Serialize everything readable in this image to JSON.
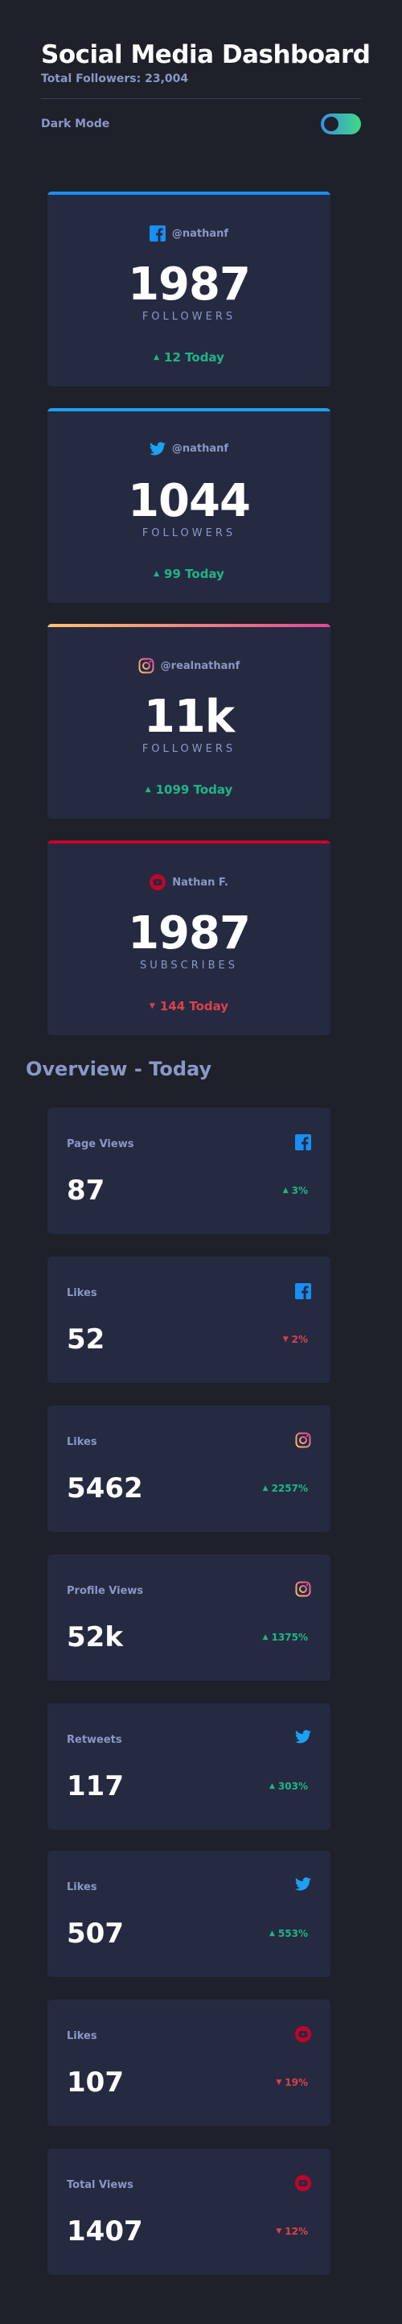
{
  "header": {
    "title": "Social Media Dashboard",
    "total_followers": "Total Followers: 23,004"
  },
  "dark_mode": {
    "label": "Dark Mode",
    "enabled": true
  },
  "colors": {
    "facebook": "#178ff5",
    "twitter": "#1ca0f2",
    "instagram_gradient": [
      "#fdc468",
      "#df4996"
    ],
    "youtube": "#c4032a",
    "up": "#1eb589",
    "down": "#dc414c"
  },
  "followers": [
    {
      "platform": "facebook",
      "icon": "facebook-icon",
      "handle": "@nathanf",
      "count": "1987",
      "label": "FOLLOWERS",
      "today": "12 Today",
      "trend": "up"
    },
    {
      "platform": "twitter",
      "icon": "twitter-icon",
      "handle": "@nathanf",
      "count": "1044",
      "label": "FOLLOWERS",
      "today": "99 Today",
      "trend": "up"
    },
    {
      "platform": "instagram",
      "icon": "instagram-icon",
      "handle": "@realnathanf",
      "count": "11k",
      "label": "FOLLOWERS",
      "today": "1099 Today",
      "trend": "up"
    },
    {
      "platform": "youtube",
      "icon": "youtube-icon",
      "handle": "Nathan F.",
      "count": "1987",
      "label": "SUBSCRIBES",
      "today": "144 Today",
      "trend": "down"
    }
  ],
  "overview": {
    "title": "Overview - Today",
    "cards": [
      {
        "label": "Page Views",
        "platform": "facebook",
        "icon": "facebook-icon",
        "value": "87",
        "percent": "3%",
        "trend": "up"
      },
      {
        "label": "Likes",
        "platform": "facebook",
        "icon": "facebook-icon",
        "value": "52",
        "percent": "2%",
        "trend": "down"
      },
      {
        "label": "Likes",
        "platform": "instagram",
        "icon": "instagram-icon",
        "value": "5462",
        "percent": "2257%",
        "trend": "up"
      },
      {
        "label": "Profile Views",
        "platform": "instagram",
        "icon": "instagram-icon",
        "value": "52k",
        "percent": "1375%",
        "trend": "up"
      },
      {
        "label": "Retweets",
        "platform": "twitter",
        "icon": "twitter-icon",
        "value": "117",
        "percent": "303%",
        "trend": "up"
      },
      {
        "label": "Likes",
        "platform": "twitter",
        "icon": "twitter-icon",
        "value": "507",
        "percent": "553%",
        "trend": "up"
      },
      {
        "label": "Likes",
        "platform": "youtube",
        "icon": "youtube-icon",
        "value": "107",
        "percent": "19%",
        "trend": "down"
      },
      {
        "label": "Total Views",
        "platform": "youtube",
        "icon": "youtube-icon",
        "value": "1407",
        "percent": "12%",
        "trend": "down"
      }
    ]
  }
}
